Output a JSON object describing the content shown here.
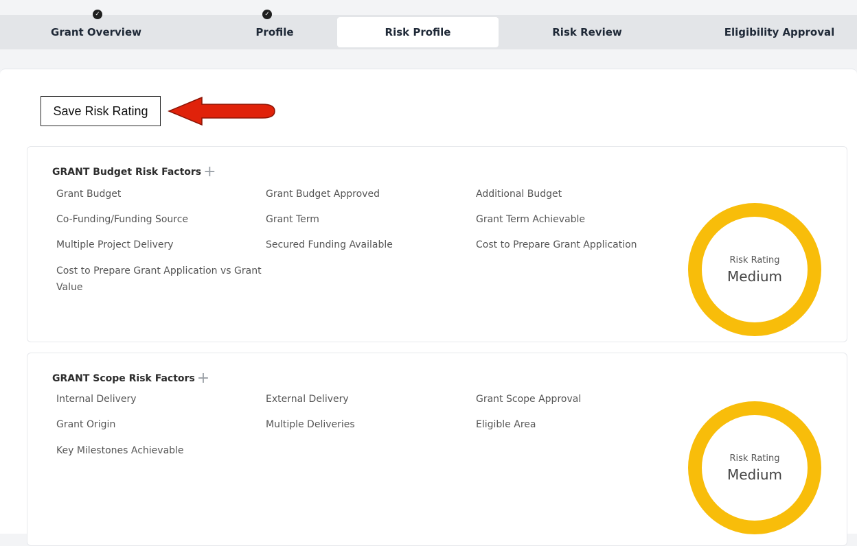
{
  "tabs": [
    {
      "label": "Grant Overview",
      "completed": true
    },
    {
      "label": "Profile",
      "completed": true
    },
    {
      "label": "Risk Profile",
      "active": true
    },
    {
      "label": "Risk Review"
    },
    {
      "label": "Eligibility Approval"
    }
  ],
  "save_button": {
    "label": "Save Risk Rating"
  },
  "colors": {
    "ring": "#f8bd0a",
    "arrow": "#e0220a"
  },
  "sections": [
    {
      "title": "GRANT Budget Risk Factors",
      "factors": [
        "Grant Budget",
        "Grant Budget Approved",
        "Additional Budget",
        "Co-Funding/Funding Source",
        "Grant Term",
        "Grant Term Achievable",
        "Multiple Project Delivery",
        "Secured Funding Available",
        "Cost to Prepare Grant Application",
        "Cost to Prepare Grant Application vs Grant Value"
      ],
      "risk_label": "Risk Rating",
      "risk_value": "Medium"
    },
    {
      "title": "GRANT Scope Risk Factors",
      "factors": [
        "Internal Delivery",
        "External Delivery",
        "Grant Scope Approval",
        "Grant Origin",
        "Multiple Deliveries",
        "Eligible Area",
        "Key Milestones Achievable"
      ],
      "risk_label": "Risk Rating",
      "risk_value": "Medium"
    }
  ]
}
